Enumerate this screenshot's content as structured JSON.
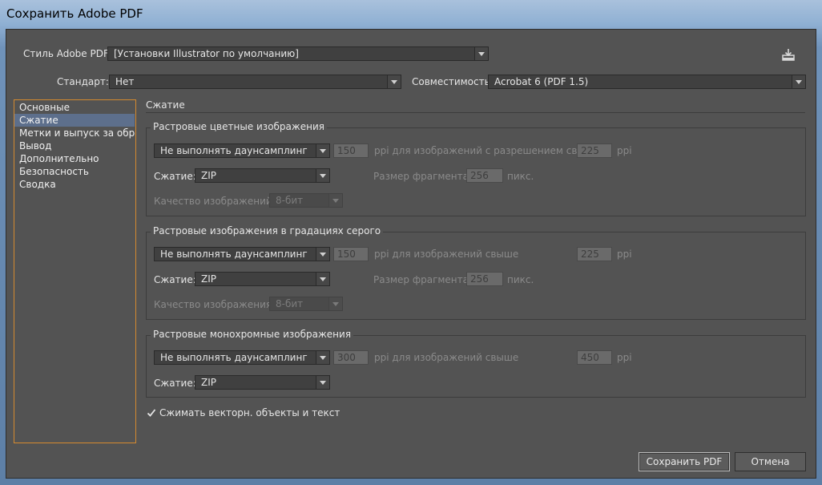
{
  "window": {
    "title": "Сохранить Adobe PDF"
  },
  "header": {
    "style_label": "Стиль Adobe PDF:",
    "style_value": "[Установки Illustrator по умолчанию]",
    "standard_label": "Стандарт:",
    "standard_value": "Нет",
    "compat_label": "Совместимость:",
    "compat_value": "Acrobat 6 (PDF 1.5)"
  },
  "sidebar": {
    "items": [
      {
        "label": "Основные",
        "selected": false
      },
      {
        "label": "Сжатие",
        "selected": true
      },
      {
        "label": "Метки и выпуск за обрез",
        "selected": false
      },
      {
        "label": "Вывод",
        "selected": false
      },
      {
        "label": "Дополнительно",
        "selected": false
      },
      {
        "label": "Безопасность",
        "selected": false
      },
      {
        "label": "Сводка",
        "selected": false
      }
    ]
  },
  "section": {
    "title": "Сжатие"
  },
  "color": {
    "title": "Растровые цветные изображения",
    "downsample": "Не выполнять даунсамплинг",
    "ppi_value": "150",
    "ppi_text": "ppi для изображений с разрешением свыше",
    "above_value": "225",
    "above_unit": "ppi",
    "compression_label": "Сжатие:",
    "compression_value": "ZIP",
    "tile_label": "Размер фрагмента:",
    "tile_value": "256",
    "tile_unit": "пикс.",
    "quality_label": "Качество изображений:",
    "quality_value": "8-бит"
  },
  "gray": {
    "title": "Растровые изображения в градациях серого",
    "downsample": "Не выполнять даунсамплинг",
    "ppi_value": "150",
    "ppi_text": "ppi для изображений свыше",
    "above_value": "225",
    "above_unit": "ppi",
    "compression_label": "Сжатие:",
    "compression_value": "ZIP",
    "tile_label": "Размер фрагмента:",
    "tile_value": "256",
    "tile_unit": "пикс.",
    "quality_label": "Качество изображения:",
    "quality_value": "8-бит"
  },
  "mono": {
    "title": "Растровые монохромные изображения",
    "downsample": "Не выполнять даунсамплинг",
    "ppi_value": "300",
    "ppi_text": "ppi для изображений свыше",
    "above_value": "450",
    "above_unit": "ppi",
    "compression_label": "Сжатие:",
    "compression_value": "ZIP"
  },
  "compress_vector": {
    "label": "Сжимать векторн. объекты и текст",
    "checked": true
  },
  "buttons": {
    "save": "Сохранить PDF",
    "cancel": "Отмена"
  },
  "icons": {
    "save_preset": "save-preset-icon"
  },
  "colors": {
    "accent_border": "#d58a2f",
    "selection": "#5d6f8c",
    "background": "#535353"
  }
}
